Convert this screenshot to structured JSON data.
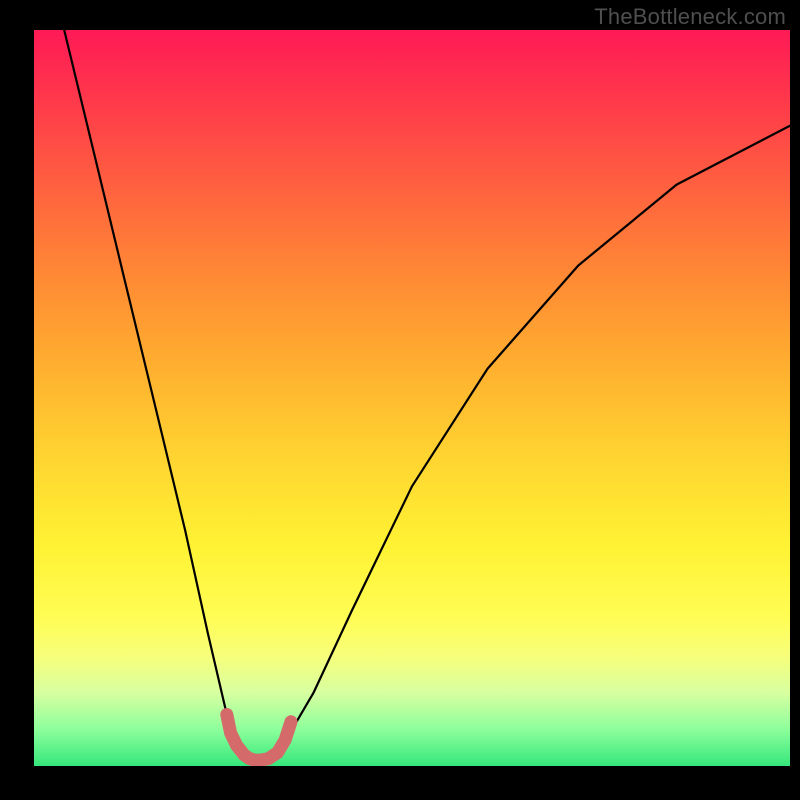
{
  "watermark": "TheBottleneck.com",
  "chart_data": {
    "type": "line",
    "title": "",
    "xlabel": "",
    "ylabel": "",
    "series": [
      {
        "name": "bottleneck-curve",
        "x": [
          0.04,
          0.08,
          0.12,
          0.16,
          0.2,
          0.23,
          0.255,
          0.27,
          0.285,
          0.295,
          0.3,
          0.315,
          0.33,
          0.37,
          0.42,
          0.5,
          0.6,
          0.72,
          0.85,
          1.0
        ],
        "y": [
          1.0,
          0.83,
          0.66,
          0.49,
          0.32,
          0.18,
          0.07,
          0.03,
          0.01,
          0.0,
          0.0,
          0.01,
          0.03,
          0.1,
          0.21,
          0.38,
          0.54,
          0.68,
          0.79,
          0.87
        ]
      },
      {
        "name": "trough-marker",
        "x": [
          0.255,
          0.26,
          0.268,
          0.278,
          0.285,
          0.292,
          0.3,
          0.31,
          0.322,
          0.332,
          0.34
        ],
        "y": [
          0.07,
          0.045,
          0.028,
          0.015,
          0.01,
          0.008,
          0.008,
          0.01,
          0.018,
          0.035,
          0.06
        ]
      }
    ],
    "xlim": [
      0,
      1
    ],
    "ylim": [
      0,
      1
    ],
    "colors": {
      "curve": "#000000",
      "marker": "#d46a6a"
    }
  }
}
